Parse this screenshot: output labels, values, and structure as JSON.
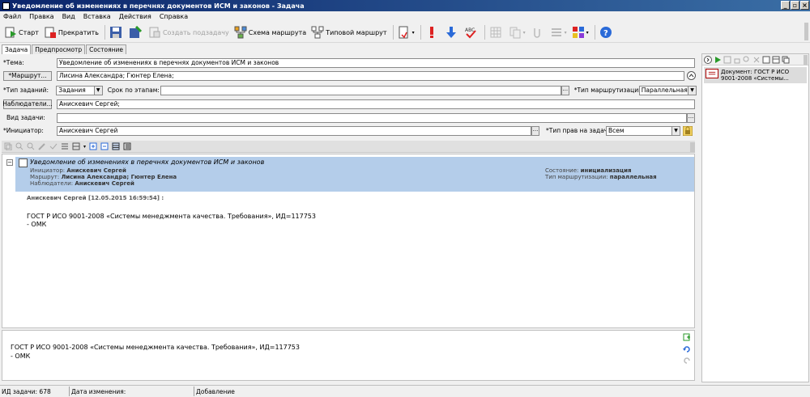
{
  "window": {
    "title": "Уведомление об изменениях в перечнях документов ИСМ и законов - Задача"
  },
  "menu": [
    "Файл",
    "Правка",
    "Вид",
    "Вставка",
    "Действия",
    "Справка"
  ],
  "toolbar": {
    "start": "Старт",
    "stop": "Прекратить",
    "create_subtask": "Создать подзадачу",
    "route_scheme": "Схема маршрута",
    "typical_route": "Типовой маршрут"
  },
  "tabs": [
    "Задача",
    "Предпросмотр",
    "Состояние"
  ],
  "form": {
    "topic_label": "*Тема:",
    "topic_value": "Уведомление об изменениях в перечнях документов ИСМ и законов",
    "route_button": "*Маршрут...",
    "route_value": "Лисина Александра; Гюнтер Елена;",
    "task_type_label": "*Тип заданий:",
    "task_type_value": "Задания",
    "stage_deadline_label": "Срок по этапам:",
    "stage_deadline_value": "",
    "routing_type_label": "*Тип маршрутизации:",
    "routing_type_value": "Параллельная",
    "observers_button": "Наблюдатели...",
    "observers_value": "Анискевич Сергей;",
    "task_kind_label": "Вид задачи:",
    "task_kind_value": "",
    "initiator_label": "*Инициатор:",
    "initiator_value": "Анискевич Сергей",
    "rights_label": "*Тип прав на задачу:",
    "rights_value": "Всем"
  },
  "task": {
    "title": "Уведомление об изменениях в перечнях документов ИСМ и законов",
    "initiator_label": "Инициатор:",
    "initiator": "Анискевич Сергей",
    "route_label": "Маршрут:",
    "route": "Лисина Александра; Гюнтер Елена",
    "observers_label": "Наблюдатели:",
    "observers": "Анискевич Сергей",
    "state_label": "Состояние:",
    "state": "инициализация",
    "routing_label": "Тип маршрутизации:",
    "routing": "параллельная",
    "comment_author": "Анискевич Сергей [12.05.2015 16:59:54] :",
    "comment_line1": "ГОСТ Р ИСО 9001-2008 «Системы менеджмента качества. Требования», ИД=117753",
    "comment_line2": "- ОМК"
  },
  "editor": {
    "line1": "ГОСТ Р ИСО 9001-2008 «Системы менеджмента качества. Требования», ИД=117753",
    "line2": " - ОМК"
  },
  "attachments": [
    {
      "line1": "Документ: ГОСТ Р ИСО",
      "line2": "9001-2008 «Системы..."
    }
  ],
  "status": {
    "task_id": "ИД задачи: 678",
    "modified": "Дата изменения:",
    "mode": "Добавление"
  }
}
